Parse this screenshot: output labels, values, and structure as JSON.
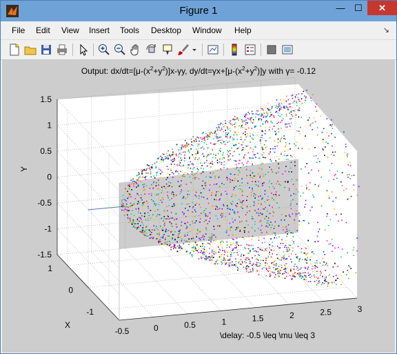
{
  "window": {
    "title": "Figure 1",
    "min_glyph": "—",
    "max_glyph": "☐",
    "close_glyph": "✕"
  },
  "menu": {
    "items": [
      "File",
      "Edit",
      "View",
      "Insert",
      "Tools",
      "Desktop",
      "Window",
      "Help"
    ],
    "arrow": "↘"
  },
  "toolbar": {
    "icons": [
      "new-figure-icon",
      "open-file-icon",
      "save-icon",
      "print-icon",
      "pointer-icon",
      "zoom-in-icon",
      "zoom-out-icon",
      "pan-hand-icon",
      "rotate-3d-icon",
      "data-cursor-icon",
      "brush-icon",
      "brush-dropdown-icon",
      "link-plot-icon",
      "colorbar-icon",
      "legend-icon",
      "hide-plot-tools-icon",
      "show-plot-tools-icon"
    ]
  },
  "chart_data": {
    "type": "scatter",
    "title_prefix": "Output: dx/dt=[μ-(x",
    "title_mid1": "+y",
    "title_mid2": ")]x-γy, dy/dt=γx+[μ-(x",
    "title_mid3": "+y",
    "title_suffix": ")]y with γ= -0.12",
    "title_superscript": "2",
    "xlabel": "\\delay: -0.5 \\leq \\mu \\leq 3",
    "ylabel": "X",
    "zlabel": "Y",
    "mu_ticks": [
      "-0.5",
      "0",
      "0.5",
      "1",
      "1.5",
      "2",
      "2.5",
      "3"
    ],
    "x_ticks": [
      "1",
      "0",
      "-1"
    ],
    "y_ticks": [
      "1.5",
      "1",
      "0.5",
      "0",
      "-0.5",
      "-1",
      "-1.5"
    ],
    "mu_range": [
      -0.5,
      3
    ],
    "x_range": [
      -1.5,
      1.5
    ],
    "y_range": [
      -1.5,
      1.5
    ],
    "grid": true,
    "description_of_surface": "Fixed point at origin for mu<0; limit-cycle cone of radius sqrt(mu) for mu>0, plotted as multicolored points"
  }
}
